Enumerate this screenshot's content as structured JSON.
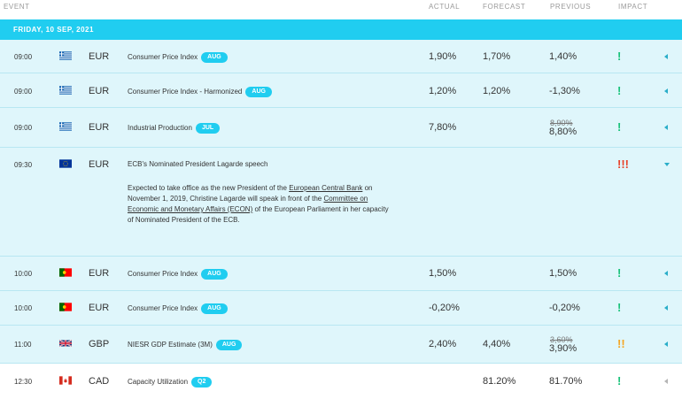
{
  "header": {
    "event": "EVENT",
    "actual": "ACTUAL",
    "forecast": "FORECAST",
    "previous": "PREVIOUS",
    "impact": "IMPACT"
  },
  "date_label": "FRIDAY, 10 SEP, 2021",
  "colors": {
    "accent": "#20cdf0",
    "row_bg": "#dff6fb",
    "impact_low": "#19c27a",
    "impact_medium": "#f5a623",
    "impact_high": "#e8432a"
  },
  "rows": [
    {
      "time": "09:00",
      "flag": "greece-flag-icon",
      "currency": "EUR",
      "event": "Consumer Price Index",
      "badge": "AUG",
      "actual": "1,90%",
      "forecast": "1,70%",
      "previous": "1,40%",
      "previous_old": "",
      "impact": "!"
    },
    {
      "time": "09:00",
      "flag": "greece-flag-icon",
      "currency": "EUR",
      "event": "Consumer Price Index - Harmonized",
      "badge": "AUG",
      "actual": "1,20%",
      "forecast": "1,20%",
      "previous": "-1,30%",
      "previous_old": "",
      "impact": "!"
    },
    {
      "time": "09:00",
      "flag": "greece-flag-icon",
      "currency": "EUR",
      "event": "Industrial Production",
      "badge": "JUL",
      "actual": "7,80%",
      "forecast": "",
      "previous": "8,80%",
      "previous_old": "8,90%",
      "impact": "!"
    },
    {
      "time": "09:30",
      "flag": "eu-flag-icon",
      "currency": "EUR",
      "event": "ECB's Nominated President Lagarde speech",
      "badge": "",
      "actual": "",
      "forecast": "",
      "previous": "",
      "previous_old": "",
      "impact": "!!!",
      "description": {
        "part1": "Expected to take office as the new President of the ",
        "link1": "European Central Bank",
        "part2": " on November 1, 2019, Christine Lagarde will speak in front of the ",
        "link2": "Committee on Economic and Monetary Affairs (ECON)",
        "part3": " of the European Parliament in her capacity of Nominated President of the ECB."
      }
    },
    {
      "time": "10:00",
      "flag": "portugal-flag-icon",
      "currency": "EUR",
      "event": "Consumer Price Index",
      "badge": "AUG",
      "actual": "1,50%",
      "forecast": "",
      "previous": "1,50%",
      "previous_old": "",
      "impact": "!"
    },
    {
      "time": "10:00",
      "flag": "portugal-flag-icon",
      "currency": "EUR",
      "event": "Consumer Price Index",
      "badge": "AUG",
      "actual": "-0,20%",
      "forecast": "",
      "previous": "-0,20%",
      "previous_old": "",
      "impact": "!"
    },
    {
      "time": "11:00",
      "flag": "uk-flag-icon",
      "currency": "GBP",
      "event": "NIESR GDP Estimate (3M)",
      "badge": "AUG",
      "actual": "2,40%",
      "forecast": "4,40%",
      "previous": "3,90%",
      "previous_old": "3,60%",
      "impact": "!!"
    },
    {
      "time": "12:30",
      "flag": "canada-flag-icon",
      "currency": "CAD",
      "event": "Capacity Utilization",
      "badge": "Q2",
      "actual": "",
      "forecast": "81.20%",
      "previous": "81.70%",
      "previous_old": "",
      "impact": "!"
    }
  ]
}
